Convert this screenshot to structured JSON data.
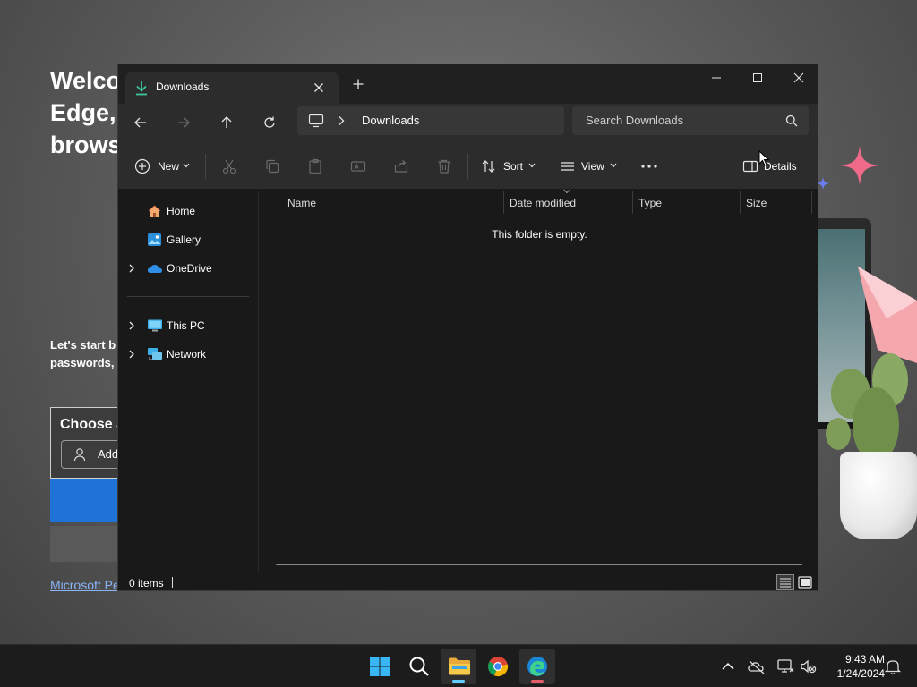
{
  "background": {
    "title": "Welco\nEdge,\nbrows",
    "subtitle": "Let's start b\npasswords,",
    "card_title": "Choose a",
    "add_button": "Add",
    "link": "Microsoft Pe"
  },
  "window": {
    "tab_label": "Downloads",
    "address": "Downloads",
    "search_placeholder": "Search Downloads",
    "toolbar": {
      "new_label": "New",
      "sort_label": "Sort",
      "view_label": "View",
      "details_label": "Details"
    },
    "sidebar": {
      "items": [
        {
          "label": "Home",
          "icon": "home-icon"
        },
        {
          "label": "Gallery",
          "icon": "gallery-icon"
        },
        {
          "label": "OneDrive",
          "icon": "onedrive-icon"
        },
        {
          "label": "This PC",
          "icon": "pc-icon"
        },
        {
          "label": "Network",
          "icon": "network-icon"
        }
      ]
    },
    "columns": [
      "Name",
      "Date modified",
      "Type",
      "Size"
    ],
    "empty_message": "This folder is empty.",
    "status": "0 items"
  },
  "taskbar": {
    "time": "9:43 AM",
    "date": "1/24/2024"
  },
  "colors": {
    "accent": "#60cdff",
    "window_bg": "#191919",
    "toolbar_bg": "#2c2c2c"
  }
}
